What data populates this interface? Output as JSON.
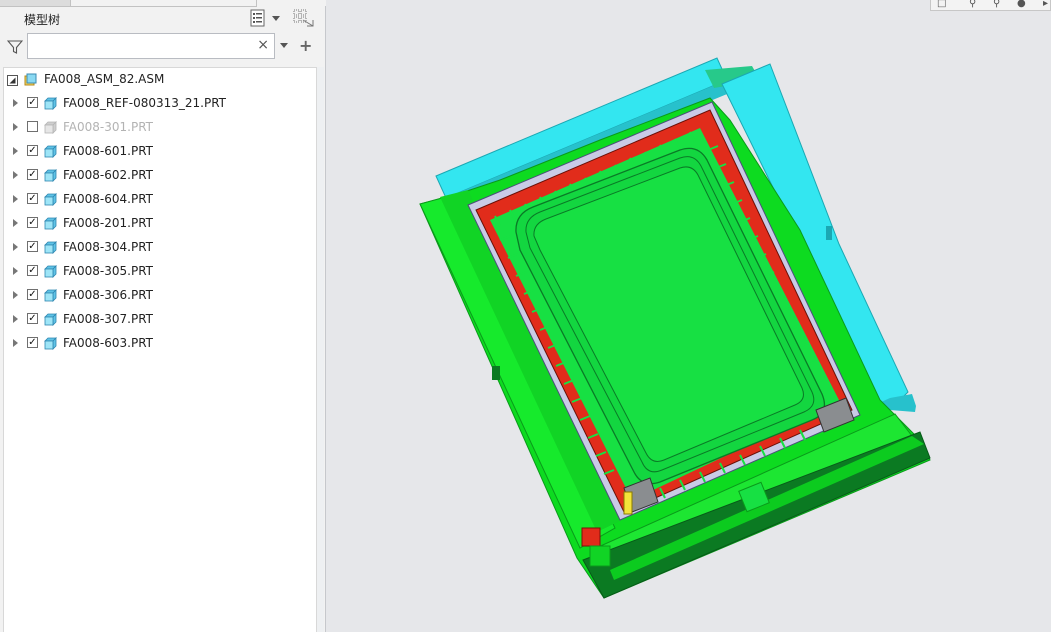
{
  "panel": {
    "title": "模型树",
    "search": {
      "value": "",
      "placeholder": ""
    },
    "clear_label": "×",
    "add_label": "+"
  },
  "tree": {
    "root": {
      "label": "FA008_ASM_82.ASM",
      "expanded": true
    },
    "items": [
      {
        "label": "FA008_REF-080313_21.PRT",
        "checked": true,
        "suppressed": false
      },
      {
        "label": "FA008-301.PRT",
        "checked": false,
        "suppressed": true
      },
      {
        "label": "FA008-601.PRT",
        "checked": true,
        "suppressed": false
      },
      {
        "label": "FA008-602.PRT",
        "checked": true,
        "suppressed": false
      },
      {
        "label": "FA008-604.PRT",
        "checked": true,
        "suppressed": false
      },
      {
        "label": "FA008-201.PRT",
        "checked": true,
        "suppressed": false
      },
      {
        "label": "FA008-304.PRT",
        "checked": true,
        "suppressed": false
      },
      {
        "label": "FA008-305.PRT",
        "checked": true,
        "suppressed": false
      },
      {
        "label": "FA008-306.PRT",
        "checked": true,
        "suppressed": false
      },
      {
        "label": "FA008-307.PRT",
        "checked": true,
        "suppressed": false
      },
      {
        "label": "FA008-603.PRT",
        "checked": true,
        "suppressed": false
      }
    ]
  },
  "icons": {
    "filter": "filter-icon",
    "tree_settings": "tree-settings-icon",
    "tree_columns": "tree-columns-icon",
    "part": "part-icon",
    "assembly": "assembly-icon"
  },
  "colors": {
    "viewport_bg": "#e6e7ea",
    "plate_cyan": "#33e6f0",
    "plate_green": "#0ddb20",
    "plate_dark_green": "#0b7a22",
    "cavity_green": "#17e043",
    "rib_red": "#e12c1b",
    "insert_gray": "#8a8d90"
  }
}
